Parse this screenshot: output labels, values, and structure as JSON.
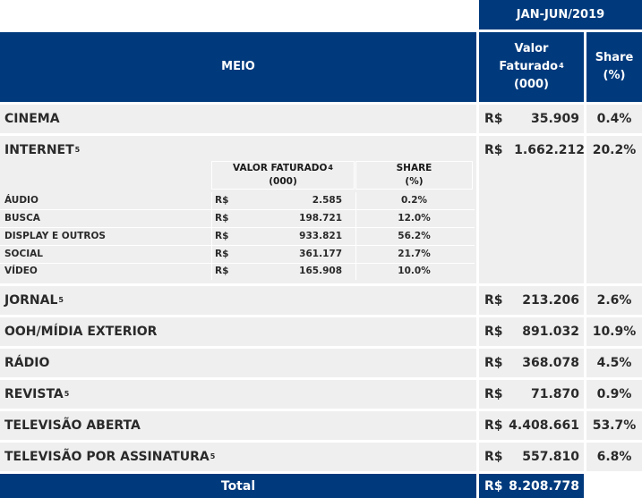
{
  "header": {
    "period": "JAN-JUN/2019",
    "meio": "MEIO",
    "valor_faturado_line1": "Valor",
    "valor_faturado_line2": "Faturado",
    "valor_faturado_sup": "4",
    "valor_faturado_line3": "(000)",
    "share_line1": "Share",
    "share_line2": "(%)"
  },
  "rows": [
    {
      "label": "CINEMA",
      "sup": "",
      "currency": "R$",
      "value": "35.909",
      "share": "0.4%"
    },
    {
      "label": "INTERNET",
      "sup": "5",
      "currency": "R$",
      "value": "1.662.212",
      "share": "20.2%"
    },
    {
      "label": "JORNAL",
      "sup": "5",
      "currency": "R$",
      "value": "213.206",
      "share": "2.6%"
    },
    {
      "label": "OOH/MÍDIA EXTERIOR",
      "sup": "",
      "currency": "R$",
      "value": "891.032",
      "share": "10.9%"
    },
    {
      "label": "RÁDIO",
      "sup": "",
      "currency": "R$",
      "value": "368.078",
      "share": "4.5%"
    },
    {
      "label": "REVISTA",
      "sup": "5",
      "currency": "R$",
      "value": "71.870",
      "share": "0.9%"
    },
    {
      "label": "TELEVISÃO ABERTA",
      "sup": "",
      "currency": "R$",
      "value": "4.408.661",
      "share": "53.7%"
    },
    {
      "label": "TELEVISÃO POR ASSINATURA",
      "sup": "5",
      "currency": "R$",
      "value": "557.810",
      "share": "6.8%"
    }
  ],
  "internet_breakdown": {
    "header_valor_line1": "VALOR FATURADO",
    "header_valor_sup": "4",
    "header_valor_line2": "(000)",
    "header_share_line1": "SHARE",
    "header_share_line2": "(%)",
    "items": [
      {
        "label": "ÁUDIO",
        "currency": "R$",
        "value": "2.585",
        "share": "0.2%"
      },
      {
        "label": "BUSCA",
        "currency": "R$",
        "value": "198.721",
        "share": "12.0%"
      },
      {
        "label": "DISPLAY E OUTROS",
        "currency": "R$",
        "value": "933.821",
        "share": "56.2%"
      },
      {
        "label": "SOCIAL",
        "currency": "R$",
        "value": "361.177",
        "share": "21.7%"
      },
      {
        "label": "VÍDEO",
        "currency": "R$",
        "value": "165.908",
        "share": "10.0%"
      }
    ]
  },
  "total": {
    "label": "Total",
    "currency": "R$",
    "value": "8.208.778"
  },
  "colors": {
    "navy": "#003a7d",
    "row_bg": "#efefef"
  }
}
